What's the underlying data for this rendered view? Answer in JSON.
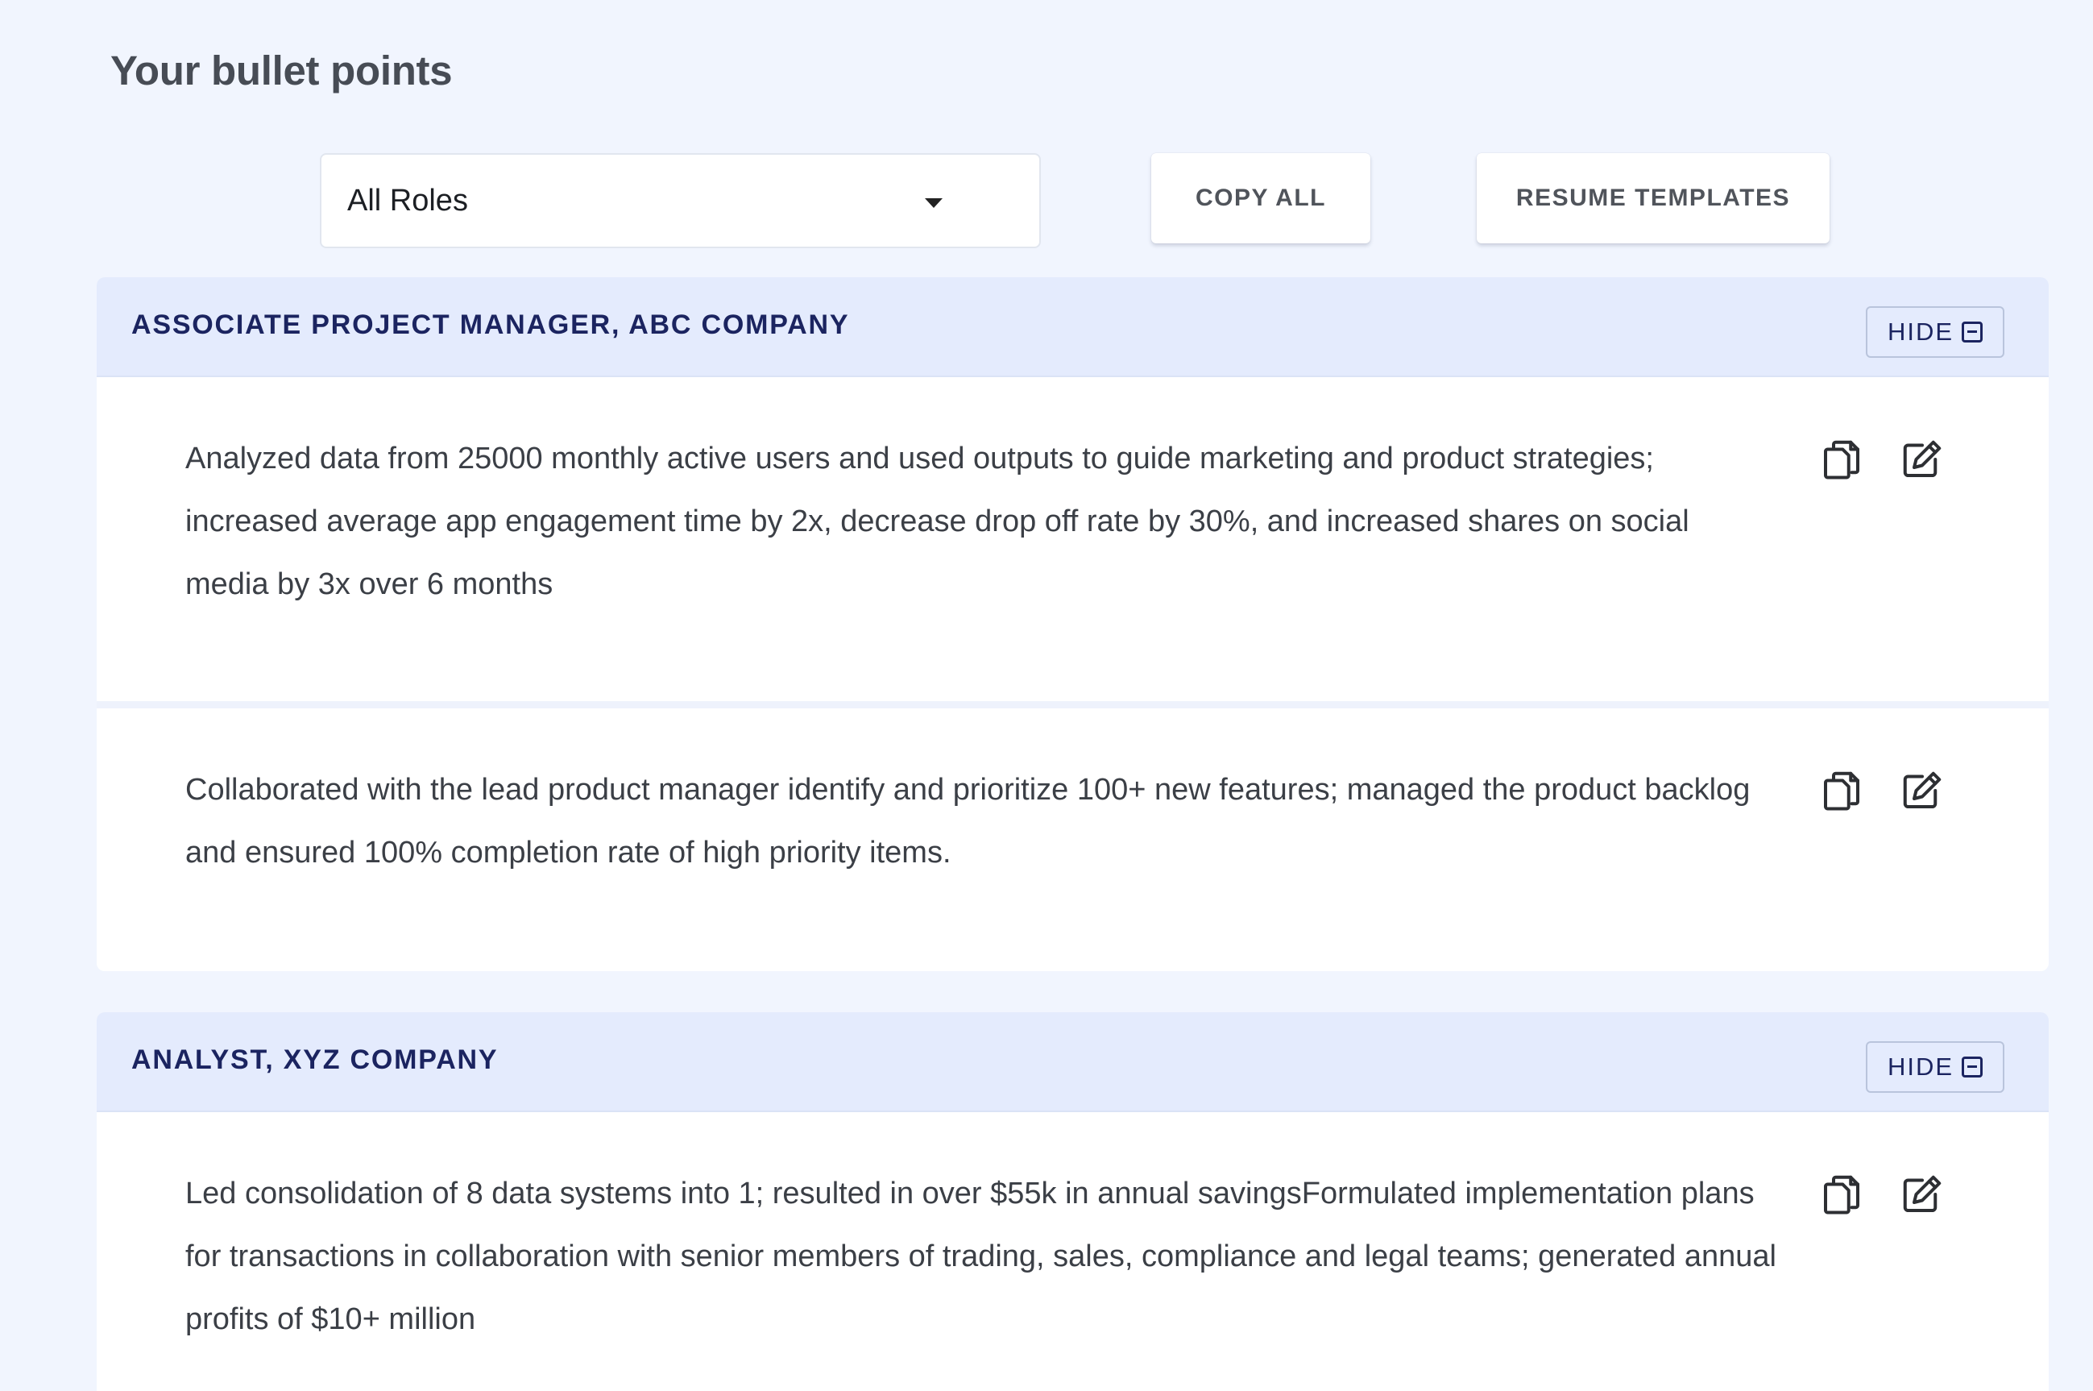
{
  "page": {
    "title": "Your bullet points"
  },
  "toolbar": {
    "role_filter": {
      "selected": "All Roles",
      "icon": "caret-down-icon"
    },
    "copy_all_label": "COPY ALL",
    "resume_templates_label": "RESUME TEMPLATES"
  },
  "roles": [
    {
      "title": "ASSOCIATE PROJECT MANAGER, ABC COMPANY",
      "hide_label": "HIDE",
      "hide_icon": "collapse-square-icon",
      "bullets": [
        {
          "text": "Analyzed data from 25000 monthly active users and used outputs to guide marketing and product strategies; increased average app engagement time by 2x, decrease drop off rate by 30%, and increased shares on social media by 3x over 6 months",
          "copy_icon": "copy-icon",
          "edit_icon": "edit-icon"
        },
        {
          "text": "Collaborated with the lead product manager identify and prioritize 100+ new features; managed the product backlog and ensured 100% completion rate of high priority items.",
          "copy_icon": "copy-icon",
          "edit_icon": "edit-icon"
        }
      ]
    },
    {
      "title": "ANALYST, XYZ COMPANY",
      "hide_label": "HIDE",
      "hide_icon": "collapse-square-icon",
      "bullets": [
        {
          "text": "Led consolidation of 8 data systems into 1; resulted in over $55k in annual savingsFormulated implementation plans for transactions in collaboration with senior members of trading, sales, compliance and legal teams; generated annual profits of $10+ million",
          "copy_icon": "copy-icon",
          "edit_icon": "edit-icon"
        }
      ]
    }
  ],
  "colors": {
    "page_background": "#f1f5fe",
    "card_header_background": "#e4ebfd",
    "role_title": "#1b2460",
    "body_text": "#3b3f46"
  }
}
